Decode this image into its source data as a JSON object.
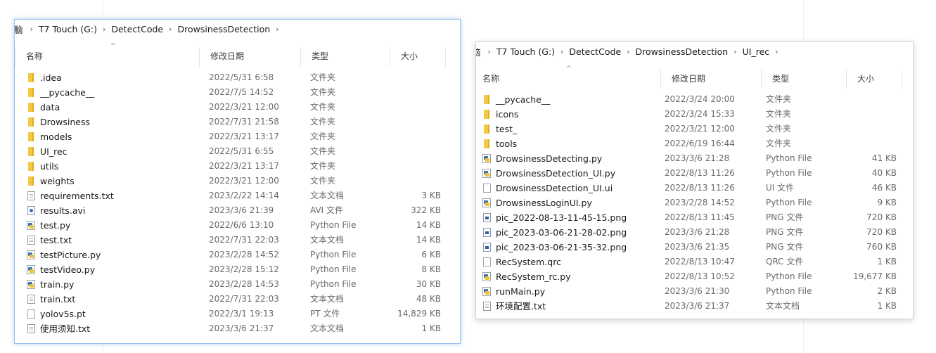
{
  "left_window": {
    "breadcrumb": [
      "脑",
      "T7 Touch (G:)",
      "DetectCode",
      "DrowsinessDetection"
    ],
    "columns": {
      "name": "名称",
      "date": "修改日期",
      "type": "类型",
      "size": "大小"
    },
    "files": [
      {
        "name": ".idea",
        "date": "2022/5/31 6:58",
        "type": "文件夹",
        "size": "",
        "icon": "folder-icon"
      },
      {
        "name": "__pycache__",
        "date": "2022/7/5 14:52",
        "type": "文件夹",
        "size": "",
        "icon": "folder-icon"
      },
      {
        "name": "data",
        "date": "2022/3/21 12:00",
        "type": "文件夹",
        "size": "",
        "icon": "folder-icon"
      },
      {
        "name": "Drowsiness",
        "date": "2022/7/31 21:58",
        "type": "文件夹",
        "size": "",
        "icon": "folder-icon"
      },
      {
        "name": "models",
        "date": "2022/3/21 13:17",
        "type": "文件夹",
        "size": "",
        "icon": "folder-icon"
      },
      {
        "name": "UI_rec",
        "date": "2022/5/31 6:55",
        "type": "文件夹",
        "size": "",
        "icon": "folder-icon"
      },
      {
        "name": "utils",
        "date": "2022/3/21 13:17",
        "type": "文件夹",
        "size": "",
        "icon": "folder-icon"
      },
      {
        "name": "weights",
        "date": "2022/3/21 12:00",
        "type": "文件夹",
        "size": "",
        "icon": "folder-icon"
      },
      {
        "name": "requirements.txt",
        "date": "2023/2/22 14:14",
        "type": "文本文档",
        "size": "3 KB",
        "icon": "text-file-icon"
      },
      {
        "name": "results.avi",
        "date": "2023/3/6 21:39",
        "type": "AVI 文件",
        "size": "322 KB",
        "icon": "video-file-icon"
      },
      {
        "name": "test.py",
        "date": "2022/6/6 13:10",
        "type": "Python File",
        "size": "14 KB",
        "icon": "python-file-icon"
      },
      {
        "name": "test.txt",
        "date": "2022/7/31 22:03",
        "type": "文本文档",
        "size": "14 KB",
        "icon": "text-file-icon"
      },
      {
        "name": "testPicture.py",
        "date": "2023/2/28 14:52",
        "type": "Python File",
        "size": "6 KB",
        "icon": "python-file-icon"
      },
      {
        "name": "testVideo.py",
        "date": "2023/2/28 15:12",
        "type": "Python File",
        "size": "8 KB",
        "icon": "python-file-icon"
      },
      {
        "name": "train.py",
        "date": "2023/2/28 14:53",
        "type": "Python File",
        "size": "30 KB",
        "icon": "python-file-icon"
      },
      {
        "name": "train.txt",
        "date": "2022/7/31 22:03",
        "type": "文本文档",
        "size": "48 KB",
        "icon": "text-file-icon"
      },
      {
        "name": "yolov5s.pt",
        "date": "2022/3/1 19:13",
        "type": "PT 文件",
        "size": "14,829 KB",
        "icon": "blank-file-icon"
      },
      {
        "name": "使用须知.txt",
        "date": "2023/3/6 21:37",
        "type": "文本文档",
        "size": "1 KB",
        "icon": "text-file-icon"
      }
    ]
  },
  "right_window": {
    "breadcrumb": [
      "脑",
      "T7 Touch (G:)",
      "DetectCode",
      "DrowsinessDetection",
      "UI_rec"
    ],
    "columns": {
      "name": "名称",
      "date": "修改日期",
      "type": "类型",
      "size": "大小"
    },
    "files": [
      {
        "name": "__pycache__",
        "date": "2022/3/24 20:00",
        "type": "文件夹",
        "size": "",
        "icon": "folder-icon"
      },
      {
        "name": "icons",
        "date": "2022/3/24 15:33",
        "type": "文件夹",
        "size": "",
        "icon": "folder-icon"
      },
      {
        "name": "test_",
        "date": "2022/3/21 12:00",
        "type": "文件夹",
        "size": "",
        "icon": "folder-icon"
      },
      {
        "name": "tools",
        "date": "2022/6/19 16:44",
        "type": "文件夹",
        "size": "",
        "icon": "folder-icon"
      },
      {
        "name": "DrowsinessDetecting.py",
        "date": "2023/3/6 21:28",
        "type": "Python File",
        "size": "41 KB",
        "icon": "python-file-icon"
      },
      {
        "name": "DrowsinessDetection_UI.py",
        "date": "2022/8/13 11:26",
        "type": "Python File",
        "size": "40 KB",
        "icon": "python-file-icon"
      },
      {
        "name": "DrowsinessDetection_UI.ui",
        "date": "2022/8/13 11:26",
        "type": "UI 文件",
        "size": "46 KB",
        "icon": "blank-file-icon"
      },
      {
        "name": "DrowsinessLoginUI.py",
        "date": "2023/2/28 14:52",
        "type": "Python File",
        "size": "9 KB",
        "icon": "python-file-icon"
      },
      {
        "name": "pic_2022-08-13-11-45-15.png",
        "date": "2022/8/13 11:45",
        "type": "PNG 文件",
        "size": "720 KB",
        "icon": "image-file-icon"
      },
      {
        "name": "pic_2023-03-06-21-28-02.png",
        "date": "2023/3/6 21:28",
        "type": "PNG 文件",
        "size": "720 KB",
        "icon": "image-file-icon"
      },
      {
        "name": "pic_2023-03-06-21-35-32.png",
        "date": "2023/3/6 21:35",
        "type": "PNG 文件",
        "size": "760 KB",
        "icon": "image-file-icon"
      },
      {
        "name": "RecSystem.qrc",
        "date": "2022/8/13 10:47",
        "type": "QRC 文件",
        "size": "1 KB",
        "icon": "blank-file-icon"
      },
      {
        "name": "RecSystem_rc.py",
        "date": "2022/8/13 10:52",
        "type": "Python File",
        "size": "19,677 KB",
        "icon": "python-file-icon"
      },
      {
        "name": "runMain.py",
        "date": "2023/3/6 21:30",
        "type": "Python File",
        "size": "2 KB",
        "icon": "python-file-icon"
      },
      {
        "name": "环境配置.txt",
        "date": "2023/3/6 21:37",
        "type": "文本文档",
        "size": "1 KB",
        "icon": "text-file-icon"
      }
    ]
  }
}
